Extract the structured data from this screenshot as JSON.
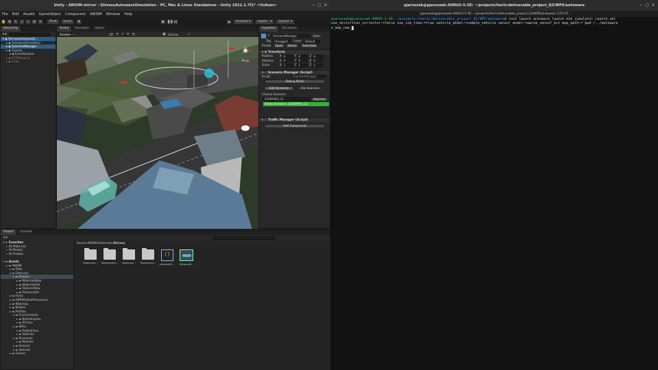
{
  "unity": {
    "title": "Unity - AWSIM-mirror - ShirasuAutowareSimulation - PC, Mac & Linux Standalone - Unity 2021.1.7f1* <Vulkan>",
    "menu": [
      "File",
      "Edit",
      "Assets",
      "GameObject",
      "Component",
      "AWSIM",
      "Window",
      "Help"
    ],
    "toolbar": {
      "pivot": "Pivot",
      "local": "Local",
      "account": "Account",
      "layers": "Layers",
      "layout": "Layout"
    },
    "hierarchy": {
      "tab": "Hierarchy",
      "items": [
        {
          "label": "ShirasuAutowareSi...",
          "indent": 0,
          "state": "sel"
        },
        {
          "label": "AutowareSimulation",
          "indent": 1,
          "state": ""
        },
        {
          "label": "ScenarioManager",
          "indent": 1,
          "state": "sel"
        },
        {
          "label": "Canvas",
          "indent": 1,
          "state": ""
        },
        {
          "label": "EventSystem",
          "indent": 2,
          "state": ""
        },
        {
          "label": "PCDMapping",
          "indent": 1,
          "state": "dim"
        },
        {
          "label": "Cube",
          "indent": 1,
          "state": "dim"
        }
      ]
    },
    "scene": {
      "tabs": [
        "Scene",
        "Animator",
        "Game"
      ],
      "shaded": "Shaded",
      "two_d": "2D",
      "gizmos": "Gizmos",
      "persp": "Persp"
    },
    "inspector": {
      "tabs": [
        "Inspector",
        "Occlusion"
      ],
      "object_name": "ScenarioManager",
      "static": "Static",
      "tag_label": "Tag",
      "tag_value": "Untagged",
      "layer_label": "Layer",
      "layer_value": "Default",
      "prefab_label": "Prefab",
      "prefab_open": "Open",
      "prefab_select": "Select",
      "prefab_overrides": "Overrides",
      "transform": {
        "title": "Transform",
        "rows": [
          {
            "label": "Position",
            "x": "0",
            "y": "0",
            "z": "0"
          },
          {
            "label": "Rotation",
            "x": "0",
            "y": "0",
            "z": "0"
          },
          {
            "label": "Scale",
            "x": "1",
            "y": "1",
            "z": "1"
          }
        ]
      },
      "scenario_component": "Scenario Manager (Script)",
      "script_label": "Script",
      "script_value": "ScenarioManager",
      "debug_mode": "Debug Mode",
      "edit_scenario": "Edit Scenario",
      "use_scenario": "Use Scenario",
      "choose_label": "Choose Scenario",
      "choose_value": "SCENARIO_12",
      "approve": "Approve",
      "active_scenario": "Active Scenario: SCENARIO_12",
      "traffic_component": "Traffic Manager (Script)",
      "add_component": "Add Component"
    },
    "project": {
      "tabs": [
        "Project",
        "Console"
      ],
      "breadcrumb": [
        "Assets",
        "AWSIM",
        "Externals",
        "Shirasu"
      ],
      "tree": [
        {
          "label": "Favorites",
          "indent": 0,
          "head": true
        },
        {
          "label": "All Materials",
          "indent": 1
        },
        {
          "label": "All Models",
          "indent": 1
        },
        {
          "label": "All Prefabs",
          "indent": 1
        },
        {
          "label": "",
          "indent": 0
        },
        {
          "label": "Assets",
          "indent": 0,
          "head": true
        },
        {
          "label": "AWSIM",
          "indent": 1
        },
        {
          "label": "Data",
          "indent": 2
        },
        {
          "label": "Externals",
          "indent": 2
        },
        {
          "label": "Shirasu",
          "indent": 3,
          "sel": true
        },
        {
          "label": "MaterialsNew",
          "indent": 4
        },
        {
          "label": "MaterialsOld",
          "indent": 4
        },
        {
          "label": "TexturesNew",
          "indent": 4
        },
        {
          "label": "TexturesOld",
          "indent": 4
        },
        {
          "label": "Fonts",
          "indent": 2
        },
        {
          "label": "HDRPDefaultResources",
          "indent": 2
        },
        {
          "label": "Materials",
          "indent": 2
        },
        {
          "label": "Models",
          "indent": 2
        },
        {
          "label": "Prefabs",
          "indent": 2
        },
        {
          "label": "Environments",
          "indent": 3
        },
        {
          "label": "Nishishinjuku",
          "indent": 4
        },
        {
          "label": "Shirasu",
          "indent": 4
        },
        {
          "label": "NPCs",
          "indent": 3
        },
        {
          "label": "Pedestrians",
          "indent": 4
        },
        {
          "label": "Vehicles",
          "indent": 4
        },
        {
          "label": "Scenarios",
          "indent": 3
        },
        {
          "label": "Markers",
          "indent": 4
        },
        {
          "label": "Sensors",
          "indent": 3
        },
        {
          "label": "Vehicles",
          "indent": 3
        },
        {
          "label": "Scenes",
          "indent": 2
        }
      ],
      "assets": [
        {
          "label": "Materials...",
          "kind": "folder"
        },
        {
          "label": "MaterialsO...",
          "kind": "folder"
        },
        {
          "label": "Textures...",
          "kind": "folder"
        },
        {
          "label": "TexturesO...",
          "kind": "folder"
        },
        {
          "label": "shirasu01...",
          "kind": "code"
        },
        {
          "label": "ShirasuN...",
          "kind": "model"
        }
      ]
    }
  },
  "terminal": {
    "title": "pjaroszek@pjaroszek-AORUS-5-SE: ~/projects/tieriv/deliverable_project_Q3/WPS/autoware",
    "tab": "pjaroszek@pjaroszek-AORUS-5-SE: ~/projects/tieriv/deliverable_project_Q3/WPS/autoware 137x75",
    "prompt_user": "pjaroszek@pjaroszek-AORUS-5-SE",
    "prompt_path": "~/projects/tieriv/deliverable_project_Q3/WPS/autoware",
    "command_line1": "$ ros2 launch autoware_launch e2e_simulator.launch.xml",
    "command_line2": " use_distortion_corrector:=false use_sim_time:=true vehicle_model:=sample_vehicle sensor_model:=awsim_sensor_kit map_path:=`pwd`/../autoware",
    "command_line3": "e_map_new_"
  },
  "colors": {
    "unity_selection": "#2c5d87",
    "active_scenario_green": "#34b234",
    "terminal_user": "#26a269",
    "terminal_path": "#2a7bde"
  }
}
